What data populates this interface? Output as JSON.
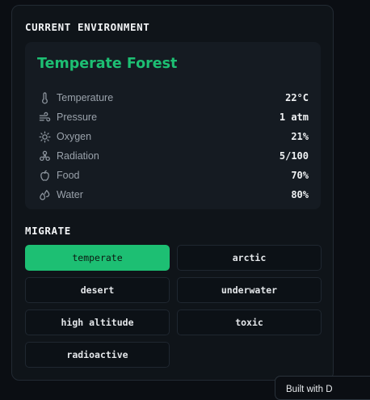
{
  "environment": {
    "section_title": "CURRENT ENVIRONMENT",
    "biome_name": "Temperate Forest",
    "stats": [
      {
        "icon": "thermometer-icon",
        "label": "Temperature",
        "value": "22°C"
      },
      {
        "icon": "wind-icon",
        "label": "Pressure",
        "value": "1 atm"
      },
      {
        "icon": "sun-icon",
        "label": "Oxygen",
        "value": "21%"
      },
      {
        "icon": "radiation-icon",
        "label": "Radiation",
        "value": "5/100"
      },
      {
        "icon": "apple-icon",
        "label": "Food",
        "value": "70%"
      },
      {
        "icon": "droplets-icon",
        "label": "Water",
        "value": "80%"
      }
    ]
  },
  "migrate": {
    "section_title": "MIGRATE",
    "options": [
      {
        "label": "temperate",
        "active": true
      },
      {
        "label": "arctic",
        "active": false
      },
      {
        "label": "desert",
        "active": false
      },
      {
        "label": "underwater",
        "active": false
      },
      {
        "label": "high altitude",
        "active": false
      },
      {
        "label": "toxic",
        "active": false
      },
      {
        "label": "radioactive",
        "active": false
      }
    ]
  },
  "footer_badge": {
    "text": "Built with D"
  },
  "colors": {
    "accent": "#1dbf73",
    "panel": "#0f1419",
    "card": "#151b22"
  }
}
